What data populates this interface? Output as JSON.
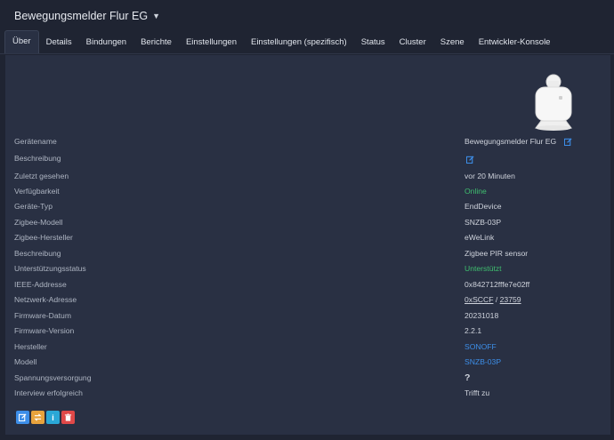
{
  "header": {
    "title": "Bewegungsmelder Flur EG"
  },
  "tabs": [
    {
      "label": "Über"
    },
    {
      "label": "Details"
    },
    {
      "label": "Bindungen"
    },
    {
      "label": "Berichte"
    },
    {
      "label": "Einstellungen"
    },
    {
      "label": "Einstellungen (spezifisch)"
    },
    {
      "label": "Status"
    },
    {
      "label": "Cluster"
    },
    {
      "label": "Szene"
    },
    {
      "label": "Entwickler-Konsole"
    }
  ],
  "info": {
    "name": {
      "label": "Gerätename",
      "value": "Bewegungsmelder Flur EG"
    },
    "description": {
      "label": "Beschreibung",
      "value": ""
    },
    "last_seen": {
      "label": "Zuletzt gesehen",
      "value": "vor 20 Minuten"
    },
    "availability": {
      "label": "Verfügbarkeit",
      "value": "Online"
    },
    "device_type": {
      "label": "Geräte-Typ",
      "value": "EndDevice"
    },
    "zigbee_model": {
      "label": "Zigbee-Modell",
      "value": "SNZB-03P"
    },
    "zigbee_manufacturer": {
      "label": "Zigbee-Hersteller",
      "value": "eWeLink"
    },
    "description2": {
      "label": "Beschreibung",
      "value": "Zigbee PIR sensor"
    },
    "support_status": {
      "label": "Unterstützungsstatus",
      "value": "Unterstützt"
    },
    "ieee": {
      "label": "IEEE-Addresse",
      "value": "0x842712fffe7e02ff"
    },
    "network": {
      "label": "Netzwerk-Adresse",
      "value_hex": "0xSCCF",
      "sep": " / ",
      "value_dec": "23759"
    },
    "fw_date": {
      "label": "Firmware-Datum",
      "value": "20231018"
    },
    "fw_version": {
      "label": "Firmware-Version",
      "value": "2.2.1"
    },
    "manufacturer": {
      "label": "Hersteller",
      "value": "SONOFF"
    },
    "model": {
      "label": "Modell",
      "value": "SNZB-03P"
    },
    "power": {
      "label": "Spannungsversorgung",
      "value": "?"
    },
    "interview": {
      "label": "Interview erfolgreich",
      "value": "Trifft zu"
    }
  },
  "actions": {
    "info_label": "i"
  },
  "colors": {
    "edit": "#3d8ee8",
    "rename": "#e8a33d",
    "info": "#2aa7d6",
    "delete": "#e04848",
    "green": "#3fbf6f",
    "blue": "#3d8ee8"
  }
}
